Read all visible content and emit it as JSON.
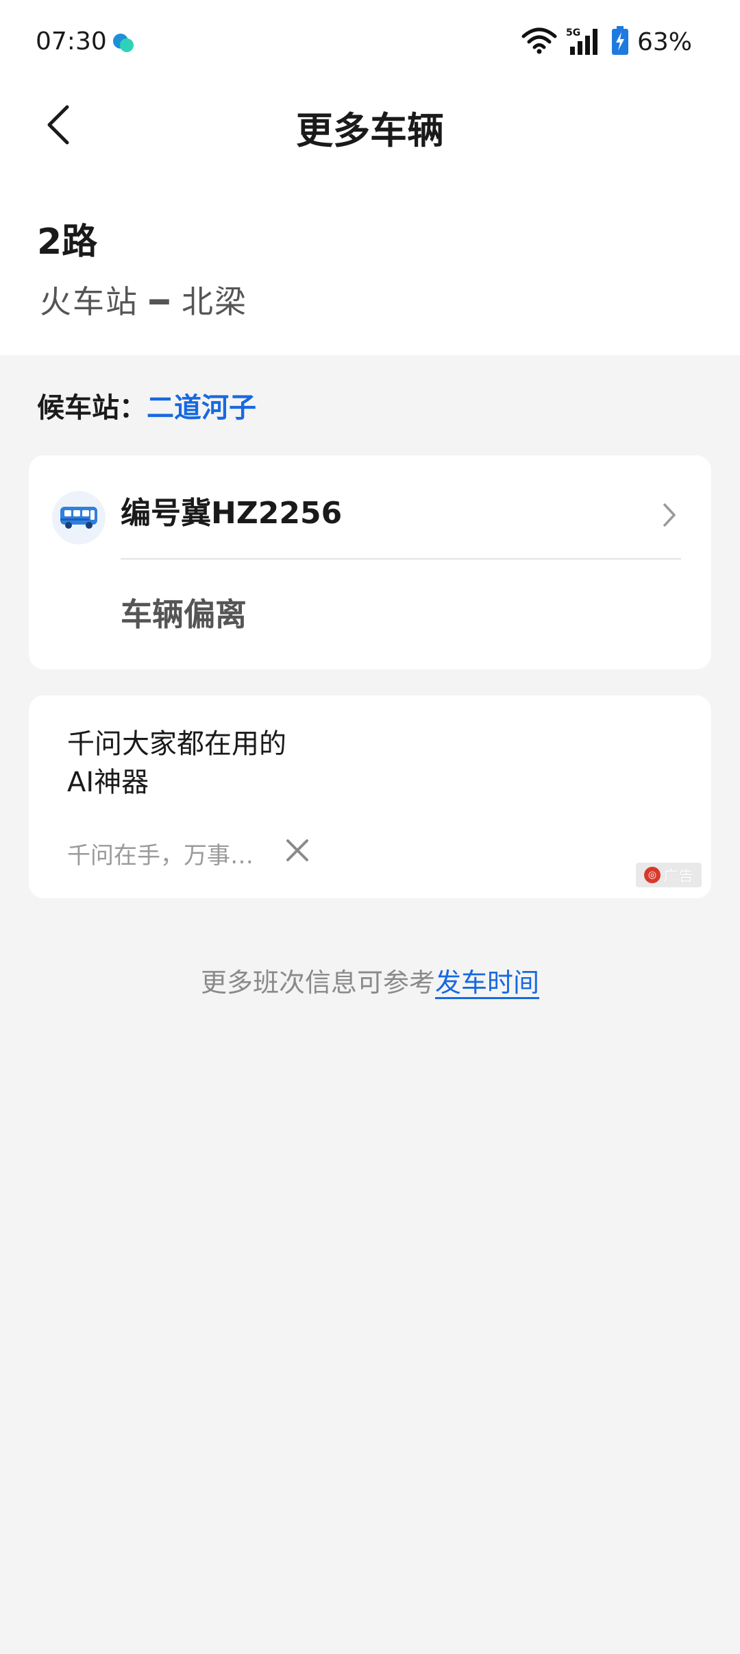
{
  "status_bar": {
    "time": "07:30",
    "network": "5G",
    "battery": "63%"
  },
  "header": {
    "title": "更多车辆"
  },
  "route": {
    "name": "2路",
    "direction": "火车站 ━ 北梁"
  },
  "waiting": {
    "label": "候车站：",
    "station": "二道河子"
  },
  "vehicle": {
    "id": "编号冀HZ2256",
    "status": "车辆偏离"
  },
  "ad": {
    "title_line1": "千问大家都在用的",
    "title_line2": "AI神器",
    "description": "千问在手，万事…",
    "badge": "广告"
  },
  "footer": {
    "text": "更多班次信息可参考",
    "link": "发车时间"
  },
  "colors": {
    "accent": "#1769e0",
    "background": "#f4f4f4",
    "card": "#ffffff"
  }
}
